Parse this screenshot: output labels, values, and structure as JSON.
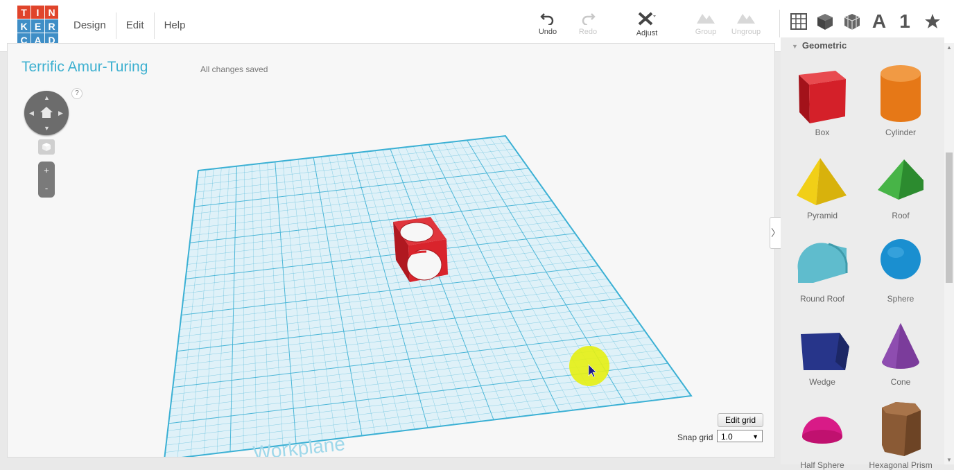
{
  "app": {
    "logo_letters": [
      "T",
      "I",
      "N",
      "K",
      "E",
      "R",
      "C",
      "A",
      "D"
    ],
    "logo_colors": [
      "#e0442b",
      "#e0442b",
      "#e0442b",
      "#3f8ec6",
      "#3f8ec6",
      "#3f8ec6",
      "#3f8ec6",
      "#3f8ec6",
      "#3f8ec6"
    ]
  },
  "menu": [
    "Design",
    "Edit",
    "Help"
  ],
  "toolbar": {
    "undo": "Undo",
    "redo": "Redo",
    "adjust": "Adjust",
    "group": "Group",
    "ungroup": "Ungroup"
  },
  "panel_tabs": {
    "text_tab": "A",
    "number_tab": "1"
  },
  "workplane": {
    "title": "Terrific Amur-Turing",
    "status": "All changes saved",
    "help": "?",
    "zoom_in": "+",
    "zoom_out": "-",
    "plane_label": "Workplane",
    "edit_grid": "Edit grid",
    "snap_label": "Snap grid",
    "snap_value": "1.0",
    "grid_color": "#3bb0d4",
    "object_color": "#d9242c"
  },
  "shapes_panel": {
    "section": "Geometric",
    "items": [
      {
        "label": "Box",
        "color": "#d42029"
      },
      {
        "label": "Cylinder",
        "color": "#e67817"
      },
      {
        "label": "Pyramid",
        "color": "#f1cf17"
      },
      {
        "label": "Roof",
        "color": "#3aa23c"
      },
      {
        "label": "Round Roof",
        "color": "#5fbccd"
      },
      {
        "label": "Sphere",
        "color": "#1a8fd0"
      },
      {
        "label": "Wedge",
        "color": "#27358a"
      },
      {
        "label": "Cone",
        "color": "#7b3c9b"
      },
      {
        "label": "Half Sphere",
        "color": "#d81b87"
      },
      {
        "label": "Hexagonal Prism",
        "color": "#8a5a35"
      }
    ]
  }
}
